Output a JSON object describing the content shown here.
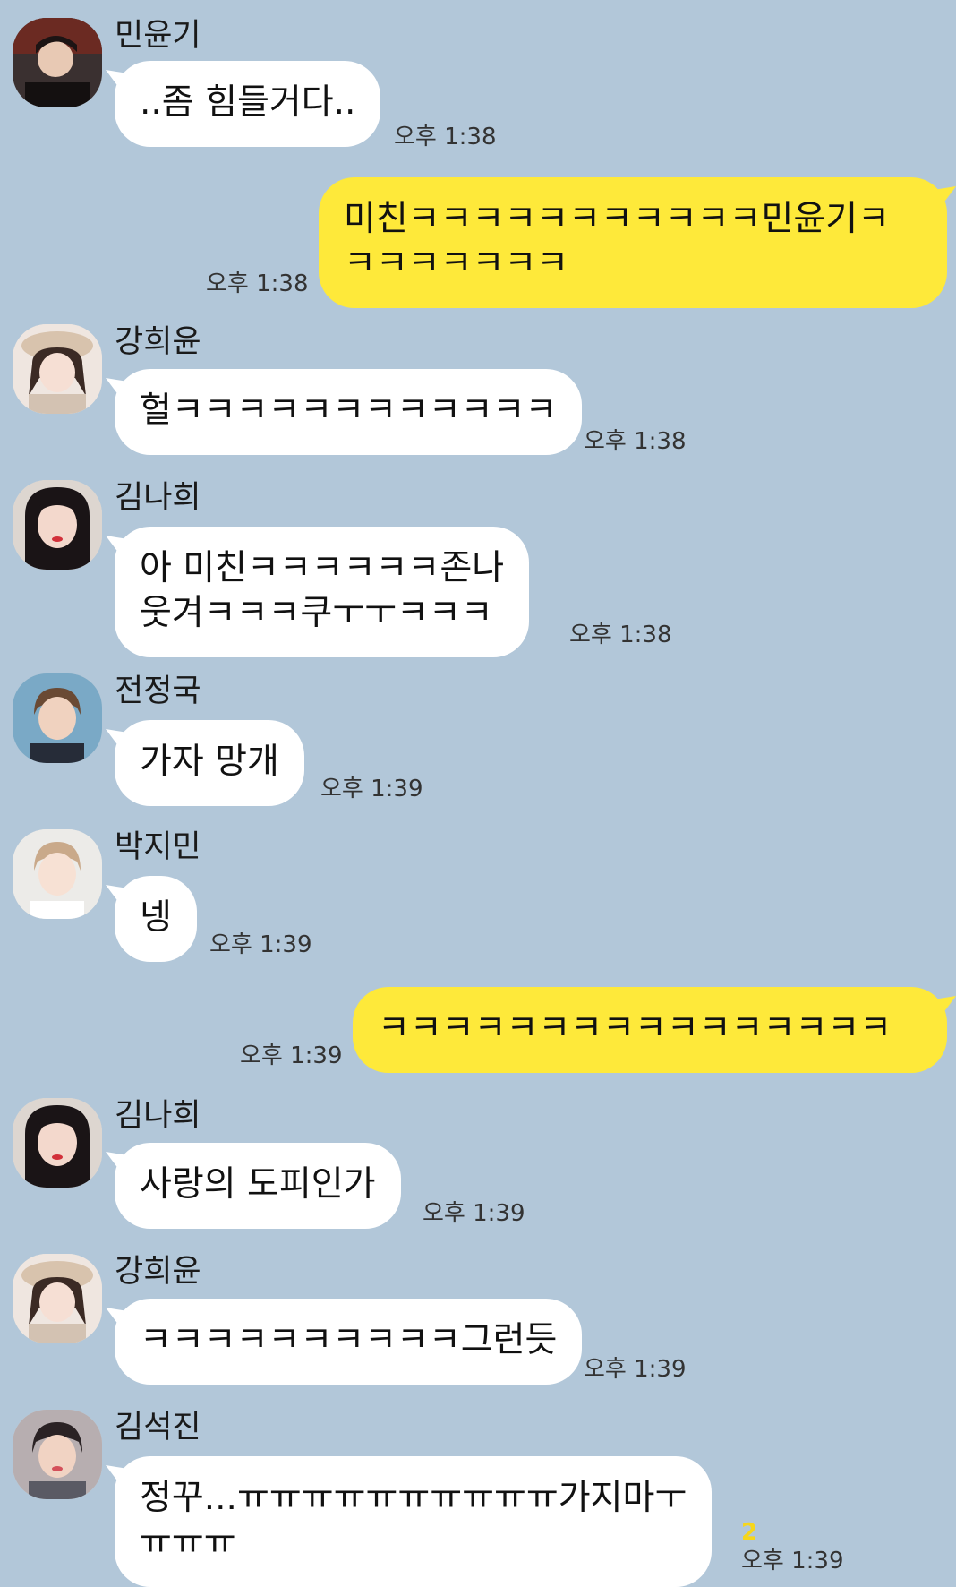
{
  "messages": [
    {
      "sender": "민윤기",
      "lines": [
        "..좀 힘들거다.."
      ],
      "time": "오후 1:38",
      "avatar_icon": "dark-hair-avatar-icon"
    },
    {
      "lines": [
        "미친ㅋㅋㅋㅋㅋㅋㅋㅋㅋㅋㅋ민윤기ㅋ",
        "ㅋㅋㅋㅋㅋㅋㅋ"
      ],
      "time": "오후 1:38"
    },
    {
      "sender": "강희윤",
      "lines": [
        "헐ㅋㅋㅋㅋㅋㅋㅋㅋㅋㅋㅋㅋ"
      ],
      "time": "오후 1:38",
      "avatar_icon": "beret-girl-avatar-icon"
    },
    {
      "sender": "김나희",
      "lines": [
        "아 미친ㅋㅋㅋㅋㅋㅋ존나",
        "웃겨ㅋㅋㅋ쿠ㅜㅜㅋㅋㅋ"
      ],
      "time": "오후 1:38",
      "avatar_icon": "black-hair-girl-avatar-icon"
    },
    {
      "sender": "전정국",
      "lines": [
        "가자 망개"
      ],
      "time": "오후 1:39",
      "avatar_icon": "brown-hair-boy-avatar-icon"
    },
    {
      "sender": "박지민",
      "lines": [
        "넹"
      ],
      "time": "오후 1:39",
      "avatar_icon": "light-hair-boy-avatar-icon"
    },
    {
      "lines": [
        "ㅋㅋㅋㅋㅋㅋㅋㅋㅋㅋㅋㅋㅋㅋㅋㅋ"
      ],
      "time": "오후 1:39"
    },
    {
      "sender": "김나희",
      "lines": [
        "사랑의 도피인가"
      ],
      "time": "오후 1:39",
      "avatar_icon": "black-hair-girl-avatar-icon"
    },
    {
      "sender": "강희윤",
      "lines": [
        "ㅋㅋㅋㅋㅋㅋㅋㅋㅋㅋ그런듯"
      ],
      "time": "오후 1:39",
      "avatar_icon": "beret-girl-avatar-icon"
    },
    {
      "sender": "김석진",
      "lines": [
        "정꾸...ㅠㅠㅠㅠㅠㅠㅠㅠㅠㅠ가지마ㅜ",
        "ㅠㅠㅠ"
      ],
      "time": "오후 1:39",
      "unread": "2",
      "avatar_icon": "dark-hair-boy-avatar-icon"
    }
  ],
  "colors": {
    "background": "#b2c7d9",
    "incoming_bubble": "#ffffff",
    "outgoing_bubble": "#fee93a",
    "unread_count": "#f6d61c"
  }
}
